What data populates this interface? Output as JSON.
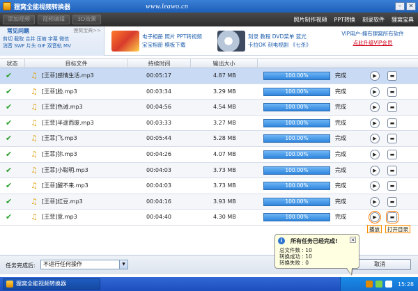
{
  "window": {
    "title": "狸窝全能视频转换器",
    "watermark": "www.leawo.cn"
  },
  "toolbar": {
    "buttons": [
      "添加视频",
      "视频编辑",
      "3D效果"
    ],
    "links": [
      "照片制作视频",
      "PPT转换",
      "刻录软件",
      "狸窝宝典"
    ]
  },
  "banner": {
    "faq_title": "常见问题",
    "faq_sub": "狸窝宝典>>",
    "faq_line1": "剪切 截取 合并 压缩 字幕 微信",
    "faq_line2": "消音 SWF 片头 GIF 双音轨 MV",
    "promo1_line1": "电子相册 照片 PPT转视频",
    "promo1_line2": "宝宝相册 模板下载",
    "promo2_line1": "刻录 教程 DVD菜单 蓝光",
    "promo2_line2": "卡拉OK 刻电视剧 《七杀》",
    "vip_line1": "VIP用户-拥有狸窝所有软件",
    "vip_line2": "点此升级VIP会员"
  },
  "table": {
    "headers": [
      "状态",
      "目标文件",
      "持续时间",
      "输出大小"
    ],
    "rows": [
      {
        "file": "[王菲]感情生活.mp3",
        "duration": "00:05:17",
        "size": "4.87 MB",
        "progress": "100.00%",
        "status": "完成"
      },
      {
        "file": "[王菲]脸.mp3",
        "duration": "00:03:34",
        "size": "3.29 MB",
        "progress": "100.00%",
        "status": "完成"
      },
      {
        "file": "[王菲]色诫.mp3",
        "duration": "00:04:56",
        "size": "4.54 MB",
        "progress": "100.00%",
        "status": "完成"
      },
      {
        "file": "[王菲]半途而废.mp3",
        "duration": "00:03:33",
        "size": "3.27 MB",
        "progress": "100.00%",
        "status": "完成"
      },
      {
        "file": "[王菲]飞.mp3",
        "duration": "00:05:44",
        "size": "5.28 MB",
        "progress": "100.00%",
        "status": "完成"
      },
      {
        "file": "[王菲]弥.mp3",
        "duration": "00:04:26",
        "size": "4.07 MB",
        "progress": "100.00%",
        "status": "完成"
      },
      {
        "file": "[王菲]小聪明.mp3",
        "duration": "00:04:03",
        "size": "3.73 MB",
        "progress": "100.00%",
        "status": "完成"
      },
      {
        "file": "[王菲]醒不来.mp3",
        "duration": "00:04:03",
        "size": "3.73 MB",
        "progress": "100.00%",
        "status": "完成"
      },
      {
        "file": "[王菲]红豆.mp3",
        "duration": "00:04:16",
        "size": "3.93 MB",
        "progress": "100.00%",
        "status": "完成"
      },
      {
        "file": "[王菲]意.mp3",
        "duration": "00:04:40",
        "size": "4.30 MB",
        "progress": "100.00%",
        "status": "完成"
      }
    ],
    "progress_fraction": 1.0
  },
  "row_tips": {
    "play": "播放",
    "open_dir": "打开目录"
  },
  "bottom": {
    "label": "任务完成后:",
    "select_value": "不进行任何操作",
    "cancel": "取消"
  },
  "balloon": {
    "title": "所有任务已经完成!",
    "total": "总文件数 : 10",
    "ok": "转换成功 : 10",
    "fail": "转换失败 : 0"
  },
  "taskbar": {
    "task": "狸窝全能视频转换器",
    "clock": "15:28"
  },
  "colors": {
    "accent": "#2f86de",
    "check": "#2aa02a",
    "link": "#1f5fae",
    "vip": "#d0021b"
  }
}
